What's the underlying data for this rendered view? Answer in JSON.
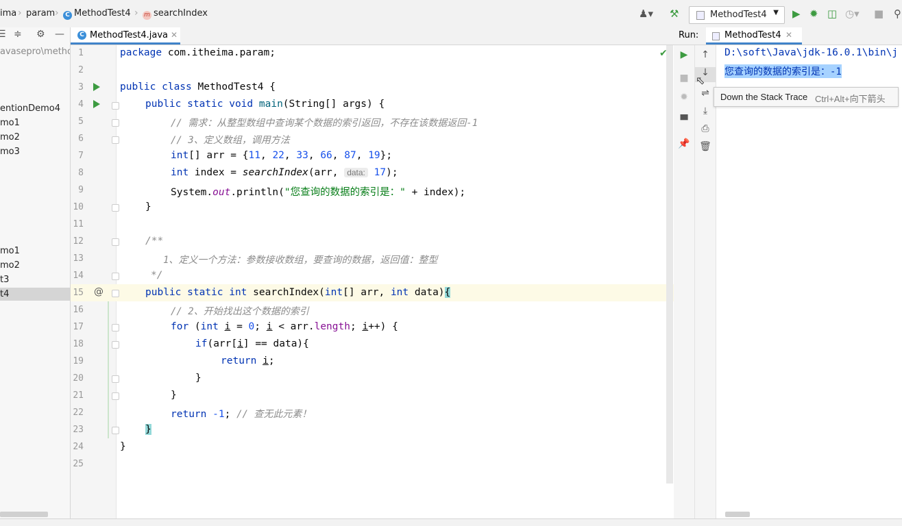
{
  "breadcrumb": {
    "items": [
      "ima",
      "param",
      "MethodTest4",
      "searchIndex"
    ]
  },
  "toolbar": {
    "run_config": "MethodTest4"
  },
  "project_panel": {
    "path_fragment": "avasepro\\metho",
    "items": [
      "entionDemo4",
      "mo1",
      "mo2",
      "mo3",
      "mo1",
      "mo2",
      "t3",
      "t4"
    ],
    "selected_index": 7
  },
  "editor": {
    "tab_label": "MethodTest4.java",
    "current_line": 15,
    "line_numbers": [
      "1",
      "2",
      "3",
      "4",
      "5",
      "6",
      "7",
      "8",
      "9",
      "10",
      "11",
      "12",
      "13",
      "14",
      "15",
      "16",
      "17",
      "18",
      "19",
      "20",
      "21",
      "22",
      "23",
      "24",
      "25"
    ],
    "code": {
      "l1": [
        "package",
        " com.itheima.param;"
      ],
      "l3": [
        "public class",
        " MethodTest4 {"
      ],
      "l4": [
        "public static void",
        " ",
        "main",
        "(String[] args) {"
      ],
      "l5": "// 需求：从整型数组中查询某个数据的索引返回，不存在该数据返回-1",
      "l6": "// 3、定义数组，调用方法",
      "l7": [
        "int",
        "[] arr = {",
        "11",
        ", ",
        "22",
        ", ",
        "33",
        ", ",
        "66",
        ", ",
        "87",
        ", ",
        "19",
        "};"
      ],
      "l8": [
        "int",
        " index = ",
        "searchIndex",
        "(arr, ",
        "data:",
        " ",
        "17",
        ");"
      ],
      "l9": [
        "System.",
        "out",
        ".println(",
        "\"您查询的数据的索引是：\"",
        " + index);"
      ],
      "l10": "}",
      "l12": "/**",
      "l13": "1、定义一个方法：参数接收数组，要查询的数据，返回值：整型",
      "l14": "*/",
      "l15": [
        "public static int",
        " searchIndex(",
        "int",
        "[] arr, ",
        "int",
        " data)",
        "{"
      ],
      "l16": "// 2、开始找出这个数据的索引",
      "l17": [
        "for",
        " (",
        "int",
        " ",
        "i",
        " = ",
        "0",
        "; ",
        "i",
        " < arr.",
        "length",
        "; ",
        "i",
        "++) {"
      ],
      "l18": [
        "if",
        "(arr[",
        "i",
        "] == data){"
      ],
      "l19": [
        "return",
        " ",
        "i",
        ";"
      ],
      "l20": "}",
      "l21": "}",
      "l22": [
        "return",
        " ",
        "-1",
        "; ",
        "// 查无此元素！"
      ],
      "l23": "}",
      "l24": "}"
    }
  },
  "run_panel": {
    "label": "Run:",
    "tab_label": "MethodTest4",
    "command_line": "D:\\soft\\Java\\jdk-16.0.1\\bin\\j",
    "output_line": "您查询的数据的索引是：-1",
    "tooltip_title": "Down the Stack Trace",
    "tooltip_shortcut": "Ctrl+Alt+向下箭头"
  },
  "colors": {
    "keyword": "#0033b3",
    "number": "#1750eb",
    "string": "#067d17",
    "comment": "#8c8c8c",
    "selection": "#a6d2ff",
    "accent": "#4083c9"
  }
}
